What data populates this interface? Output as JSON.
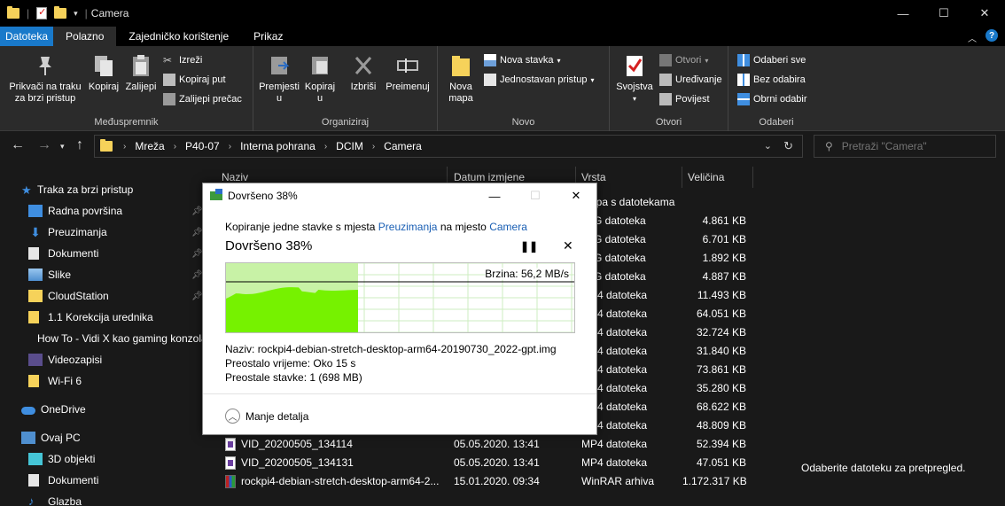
{
  "window": {
    "title": "Camera",
    "controls": {
      "minimize": "—",
      "maximize": "☐",
      "close": "✕"
    }
  },
  "ribbon_tabs": [
    "Datoteka",
    "Polazno",
    "Zajedničko korištenje",
    "Prikaz"
  ],
  "ribbon": {
    "pin_label_1": "Prikvači na traku",
    "pin_label_2": "za brzi pristup",
    "copy": "Kopiraj",
    "paste": "Zalijepi",
    "cut": "Izreži",
    "copy_path": "Kopiraj put",
    "paste_shortcut": "Zalijepi prečac",
    "group_clipboard": "Međuspremnik",
    "move_to_1": "Premjesti",
    "move_to_2": "u",
    "copy_to_1": "Kopiraj",
    "copy_to_2": "u",
    "delete": "Izbriši",
    "rename": "Preimenuj",
    "group_organize": "Organiziraj",
    "new_folder_1": "Nova",
    "new_folder_2": "mapa",
    "new_item": "Nova stavka",
    "easy_access": "Jednostavan pristup",
    "group_new": "Novo",
    "properties": "Svojstva",
    "open": "Otvori",
    "edit": "Uređivanje",
    "history": "Povijest",
    "group_open": "Otvori",
    "select_all": "Odaberi sve",
    "select_none": "Bez odabira",
    "invert_selection": "Obrni odabir",
    "group_select": "Odaberi"
  },
  "breadcrumb": [
    "Mreža",
    "P40-07",
    "Interna pohrana",
    "DCIM",
    "Camera"
  ],
  "search": {
    "placeholder": "Pretraži \"Camera\""
  },
  "sidebar": {
    "quick_access": "Traka za brzi pristup",
    "items": [
      "Radna površina",
      "Preuzimanja",
      "Dokumenti",
      "Slike",
      "CloudStation",
      "1.1 Korekcija urednika",
      "How To - Vidi X kao gaming konzola",
      "Videozapisi",
      "Wi-Fi 6"
    ],
    "onedrive": "OneDrive",
    "this_pc": "Ovaj PC",
    "pc_items": [
      "3D objekti",
      "Dokumenti",
      "Glazba"
    ]
  },
  "columns": {
    "name": "Naziv",
    "date": "Datum izmjene",
    "type": "Vrsta",
    "size": "Veličina"
  },
  "rows": [
    {
      "name": "",
      "date": "",
      "type": "Mapa s datotekama",
      "size": "",
      "icon": "none"
    },
    {
      "name": "",
      "date": "",
      "type": "JPG datoteka",
      "size": "4.861 KB",
      "icon": "none"
    },
    {
      "name": "",
      "date": "",
      "type": "JPG datoteka",
      "size": "6.701 KB",
      "icon": "none"
    },
    {
      "name": "",
      "date": "",
      "type": "JPG datoteka",
      "size": "1.892 KB",
      "icon": "none"
    },
    {
      "name": "",
      "date": "",
      "type": "JPG datoteka",
      "size": "4.887 KB",
      "icon": "none"
    },
    {
      "name": "",
      "date": "",
      "type": "MP4 datoteka",
      "size": "11.493 KB",
      "icon": "none"
    },
    {
      "name": "",
      "date": "",
      "type": "MP4 datoteka",
      "size": "64.051 KB",
      "icon": "none"
    },
    {
      "name": "",
      "date": "",
      "type": "MP4 datoteka",
      "size": "32.724 KB",
      "icon": "none"
    },
    {
      "name": "",
      "date": "",
      "type": "MP4 datoteka",
      "size": "31.840 KB",
      "icon": "none"
    },
    {
      "name": "",
      "date": "",
      "type": "MP4 datoteka",
      "size": "73.861 KB",
      "icon": "none"
    },
    {
      "name": "",
      "date": "",
      "type": "MP4 datoteka",
      "size": "35.280 KB",
      "icon": "none"
    },
    {
      "name": "",
      "date": "",
      "type": "MP4 datoteka",
      "size": "68.622 KB",
      "icon": "none"
    },
    {
      "name": "",
      "date": "",
      "type": "MP4 datoteka",
      "size": "48.809 KB",
      "icon": "none"
    },
    {
      "name": "VID_20200505_134114",
      "date": "05.05.2020. 13:41",
      "type": "MP4 datoteka",
      "size": "52.394 KB",
      "icon": "mp4"
    },
    {
      "name": "VID_20200505_134131",
      "date": "05.05.2020. 13:41",
      "type": "MP4 datoteka",
      "size": "47.051 KB",
      "icon": "mp4"
    },
    {
      "name": "rockpi4-debian-stretch-desktop-arm64-2...",
      "date": "15.01.2020. 09:34",
      "type": "WinRAR arhiva",
      "size": "1.172.317 KB",
      "icon": "rar"
    }
  ],
  "preview_text": "Odaberite datoteku za pretpregled.",
  "dialog": {
    "title": "Dovršeno 38%",
    "line_prefix": "Kopiranje jedne stavke s mjesta",
    "source": "Preuzimanja",
    "line_mid": "na mjesto",
    "destination": "Camera",
    "heading": "Dovršeno 38%",
    "progress": 0.38,
    "speed": "Brzina: 56,2 MB/s",
    "name_label": "Naziv:",
    "name_value": "rockpi4-debian-stretch-desktop-arm64-20190730_2022-gpt.img",
    "time_label": "Preostalo vrijeme:",
    "time_value": "Oko 15 s",
    "items_label": "Preostale stavke:",
    "items_value": "1 (698 MB)",
    "less_details": "Manje detalja",
    "pause": "❚❚",
    "cancel": "✕"
  },
  "colors": {
    "accent": "#1979ca",
    "graph_fill": "#76f200",
    "graph_bg_fill": "#c8f2a6",
    "link": "#1a5fb4"
  }
}
